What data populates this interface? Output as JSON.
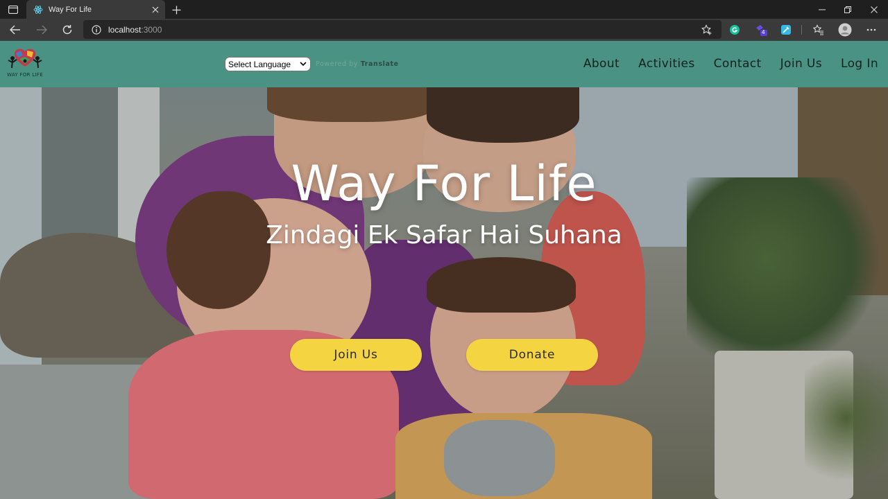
{
  "browser": {
    "tab_title": "Way For Life",
    "url_host": "localhost",
    "url_port": ":3000",
    "extension_badge": "4"
  },
  "navbar": {
    "logo_text": "WAY FOR LIFE",
    "language_select": "Select Language",
    "powered_by": "Powered by",
    "translate": "Translate",
    "links": [
      "About",
      "Activities",
      "Contact",
      "Join Us",
      "Log In"
    ]
  },
  "hero": {
    "title": "Way For Life",
    "subtitle": "Zindagi Ek Safar Hai Suhana",
    "join_button": "Join Us",
    "donate_button": "Donate"
  },
  "colors": {
    "navbar": "#4a9384",
    "button": "#f5d442",
    "chrome_dark": "#1f1f1f",
    "chrome_mid": "#3a3a3a"
  }
}
